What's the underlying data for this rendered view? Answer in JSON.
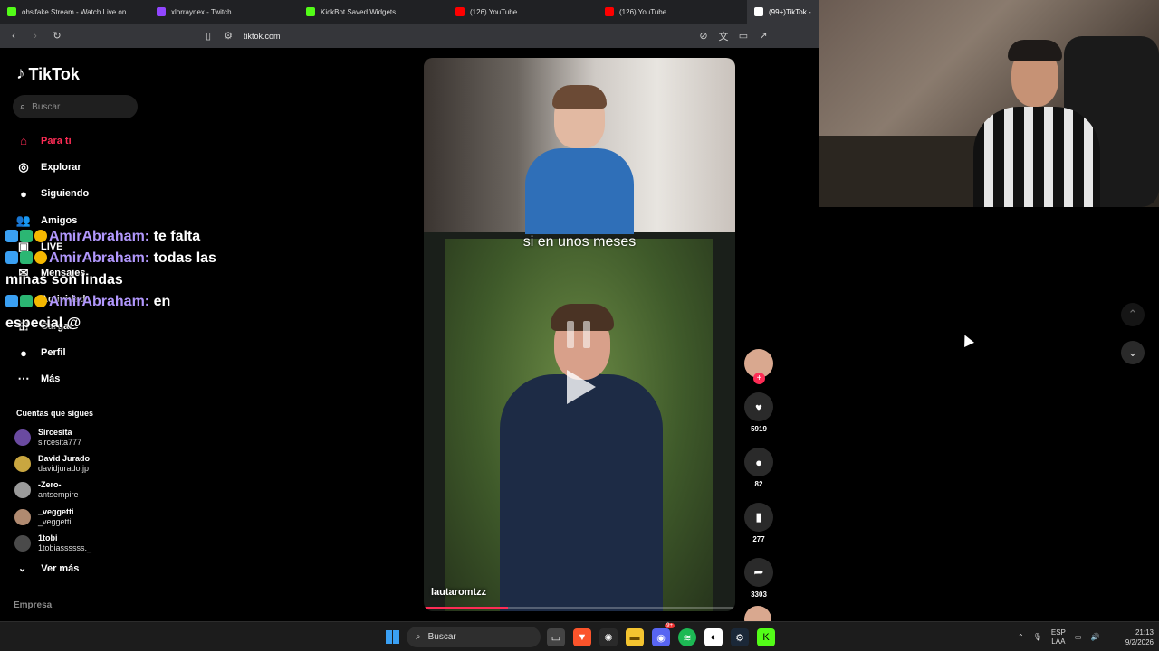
{
  "browser": {
    "tabs": [
      {
        "title": "ohsifake Stream - Watch Live on",
        "color": "#53fc18"
      },
      {
        "title": "xlorraynex - Twitch",
        "color": "#9146ff"
      },
      {
        "title": "KickBot Saved Widgets",
        "color": "#53fc18"
      },
      {
        "title": "(126) YouTube",
        "color": "#ff0000"
      },
      {
        "title": "(126) YouTube",
        "color": "#ff0000"
      },
      {
        "title": "(99+)TikTok -",
        "color": "#ffffff"
      }
    ],
    "url": "tiktok.com"
  },
  "tiktok": {
    "brand": "TikTok",
    "search_placeholder": "Buscar",
    "nav": [
      {
        "label": "Para ti",
        "icon": "home-icon",
        "glyph": "⌂",
        "active": true
      },
      {
        "label": "Explorar",
        "icon": "compass-icon",
        "glyph": "◎"
      },
      {
        "label": "Siguiendo",
        "icon": "following-icon",
        "glyph": "●"
      },
      {
        "label": "Amigos",
        "icon": "friends-icon",
        "glyph": "👥"
      },
      {
        "label": "LIVE",
        "icon": "live-icon",
        "glyph": "▣"
      },
      {
        "label": "Mensajes",
        "icon": "messages-icon",
        "glyph": "✉"
      },
      {
        "label": "Actividad",
        "icon": "activity-icon",
        "glyph": "♥"
      },
      {
        "label": "Cargar",
        "icon": "upload-icon",
        "glyph": "⊞"
      },
      {
        "label": "Perfil",
        "icon": "profile-icon",
        "glyph": "●"
      },
      {
        "label": "Más",
        "icon": "more-icon",
        "glyph": "⋯"
      }
    ],
    "following_title": "Cuentas que sigues",
    "following": [
      {
        "name": "Sircesita",
        "handle": "sircesita777",
        "color": "#6a4aa0"
      },
      {
        "name": "David Jurado",
        "handle": "davidjurado.jp",
        "color": "#c9a640"
      },
      {
        "name": "-Zero-",
        "handle": "antsempire",
        "color": "#9a9a9a"
      },
      {
        "name": "_veggetti",
        "handle": "_veggetti",
        "color": "#b08a70"
      },
      {
        "name": "1tobi",
        "handle": "1tobiassssss._",
        "color": "#4a4a4a"
      }
    ],
    "see_more": "Ver más",
    "footer": "Empresa"
  },
  "chat": [
    {
      "user": "AmirAbraham:",
      "text": " te falta"
    },
    {
      "user": "AmirAbraham:",
      "text": " todas las minas son lindas"
    },
    {
      "user": "AmirAbraham:",
      "text": " en especial @"
    }
  ],
  "video": {
    "caption": "si en unos meses",
    "author": "lautaromtzz",
    "progress": 0.27,
    "likes": "5919",
    "comments": "82",
    "saves": "277",
    "shares": "3303"
  },
  "taskbar": {
    "search_placeholder": "Buscar",
    "lang_top": "ESP",
    "lang_bottom": "LAA",
    "time": "21:13",
    "date": "9/2/2026",
    "discord_badge": "9+"
  }
}
